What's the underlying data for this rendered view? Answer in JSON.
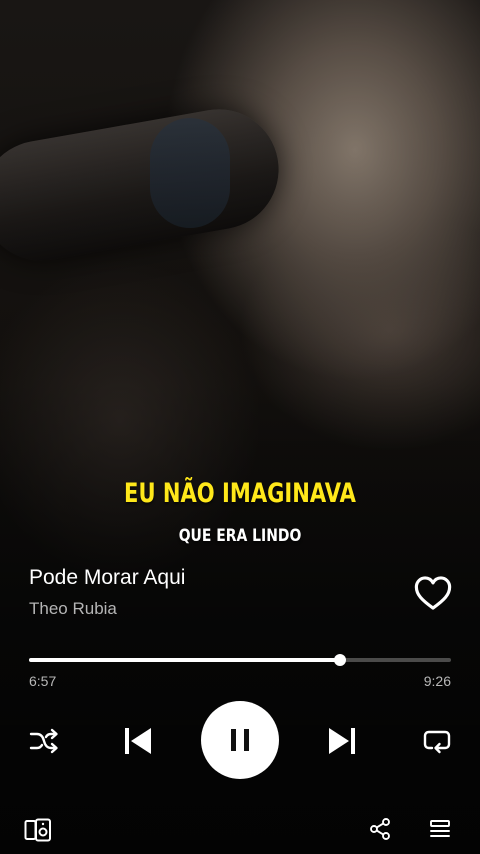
{
  "lyrics": {
    "current_line": "EU NÃO IMAGINAVA",
    "next_line": "QUE ERA LINDO"
  },
  "track": {
    "title": "Pode Morar Aqui",
    "artist": "Theo Rubia",
    "liked": false
  },
  "playback": {
    "elapsed": "6:57",
    "total": "9:26",
    "progress_fraction": 0.737,
    "state": "playing"
  },
  "colors": {
    "lyric_highlight": "#ffe81a",
    "control_foreground": "#ffffff",
    "play_button_bg": "#ffffff",
    "secondary_text": "#b5b5b5"
  },
  "controls": {
    "shuffle_icon": "shuffle-icon",
    "previous_icon": "skip-previous-icon",
    "play_pause_icon": "pause-icon",
    "next_icon": "skip-next-icon",
    "repeat_icon": "repeat-icon",
    "devices_icon": "connect-device-icon",
    "share_icon": "share-icon",
    "queue_icon": "queue-icon"
  }
}
